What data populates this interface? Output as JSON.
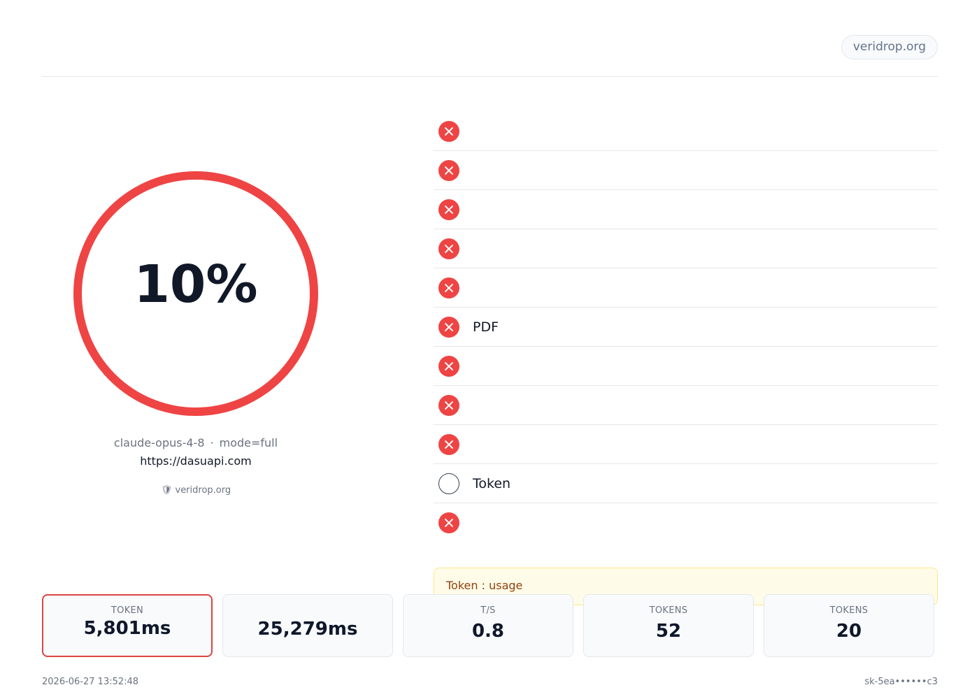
{
  "header": {
    "title": "",
    "domain": "veridrop.org"
  },
  "score": {
    "value": "10%",
    "label": "",
    "fraction": 0.1,
    "ring_color": "#ef4444"
  },
  "model": {
    "name": "claude-opus-4-8",
    "separator": "·",
    "mode": "mode=full",
    "url": "https://dasuapi.com",
    "powered_by": "🛡 veridrop.org"
  },
  "checks": [
    {
      "name": "",
      "status": "",
      "state": "fail"
    },
    {
      "name": "",
      "status": "",
      "state": "fail"
    },
    {
      "name": "",
      "status": "",
      "state": "fail"
    },
    {
      "name": "",
      "status": "",
      "state": "fail"
    },
    {
      "name": "",
      "status": "",
      "state": "fail"
    },
    {
      "name": "PDF",
      "status": "",
      "state": "fail"
    },
    {
      "name": "",
      "status": "",
      "state": "fail"
    },
    {
      "name": "",
      "status": "",
      "state": "fail"
    },
    {
      "name": "",
      "status": "",
      "state": "fail"
    },
    {
      "name": "Token",
      "status": "",
      "state": "skip"
    },
    {
      "name": "",
      "status": "",
      "state": "fail"
    }
  ],
  "warning": "Token : usage",
  "stats": [
    {
      "label": "TOKEN",
      "value": "5,801ms"
    },
    {
      "label": "",
      "value": "25,279ms"
    },
    {
      "label": "T/S",
      "value": "0.8"
    },
    {
      "label": "TOKENS",
      "value": "52"
    },
    {
      "label": "TOKENS",
      "value": "20"
    }
  ],
  "footer": {
    "left": "2026-06-27 13:52:48",
    "right": "sk-5ea••••••c3"
  },
  "colors": {
    "fail": "#ef4444",
    "fail_text": "#dc2626",
    "skip_text": "#6b7280",
    "warning_bg": "#fefce8",
    "warning_text": "#92400e"
  }
}
